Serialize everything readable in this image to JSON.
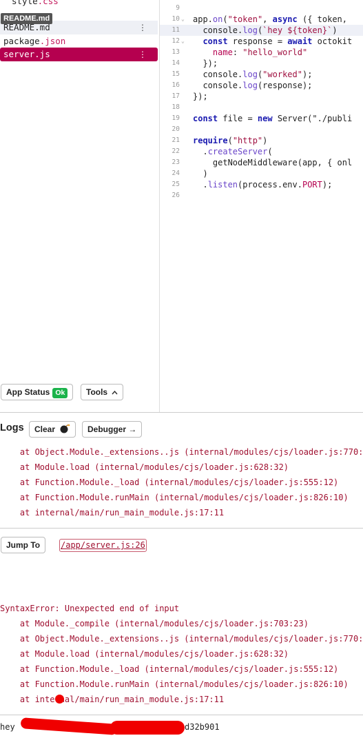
{
  "files": {
    "partial_top": "style",
    "partial_top_ext": ".css",
    "tooltip": "README.md",
    "items": [
      {
        "name": "README",
        "ext": ".md"
      },
      {
        "name": "package",
        "ext": ".json"
      },
      {
        "name": "server",
        "ext": ".js"
      }
    ],
    "menu_dots": "⋮"
  },
  "status_bar": {
    "app_status_label": "App Status",
    "ok_label": "Ok",
    "tools_label": "Tools"
  },
  "editor": {
    "lines": [
      {
        "n": "9",
        "text": ""
      },
      {
        "n": "10",
        "text": "app.on(\"token\", async ({ token,"
      },
      {
        "n": "11",
        "text": "  console.log(`hey ${token}`)"
      },
      {
        "n": "12",
        "text": "  const response = await octokit"
      },
      {
        "n": "13",
        "text": "    name: \"hello_world\""
      },
      {
        "n": "14",
        "text": "  });"
      },
      {
        "n": "15",
        "text": "  console.log(\"worked\");"
      },
      {
        "n": "16",
        "text": "  console.log(response);"
      },
      {
        "n": "17",
        "text": "});"
      },
      {
        "n": "18",
        "text": ""
      },
      {
        "n": "19",
        "text": "const file = new Server(\"./publi"
      },
      {
        "n": "20",
        "text": ""
      },
      {
        "n": "21",
        "text": "require(\"http\")"
      },
      {
        "n": "22",
        "text": "  .createServer("
      },
      {
        "n": "23",
        "text": "    getNodeMiddleware(app, { onl"
      },
      {
        "n": "24",
        "text": "  )"
      },
      {
        "n": "25",
        "text": "  .listen(process.env.PORT);"
      },
      {
        "n": "26",
        "text": ""
      }
    ]
  },
  "logs": {
    "title": "Logs",
    "clear_label": "Clear",
    "debugger_label": "Debugger →",
    "trace_top": [
      "    at Object.Module._extensions..js (internal/modules/cjs/loader.js:770:",
      "    at Module.load (internal/modules/cjs/loader.js:628:32)",
      "    at Function.Module._load (internal/modules/cjs/loader.js:555:12)",
      "    at Function.Module.runMain (internal/modules/cjs/loader.js:826:10)",
      "    at internal/main/run_main_module.js:17:11"
    ],
    "jump_to_label": "Jump To",
    "error_location": "/app/server.js:26",
    "error_message": "SyntaxError: Unexpected end of input",
    "trace_bottom": [
      "    at Module._compile (internal/modules/cjs/loader.js:703:23)",
      "    at Object.Module._extensions..js (internal/modules/cjs/loader.js:770:",
      "    at Module.load (internal/modules/cjs/loader.js:628:32)",
      "    at Function.Module._load (internal/modules/cjs/loader.js:555:12)",
      "    at Function.Module.runMain (internal/modules/cjs/loader.js:826:10)",
      "    at internal/main/run_main_module.js:17:11"
    ],
    "last_output_prefix": "hey",
    "last_output_suffix": "d32b901"
  },
  "colors": {
    "accent": "#b5004f",
    "error_text": "#a01030",
    "ok_green": "#1bb34b",
    "redaction": "#f00000"
  }
}
